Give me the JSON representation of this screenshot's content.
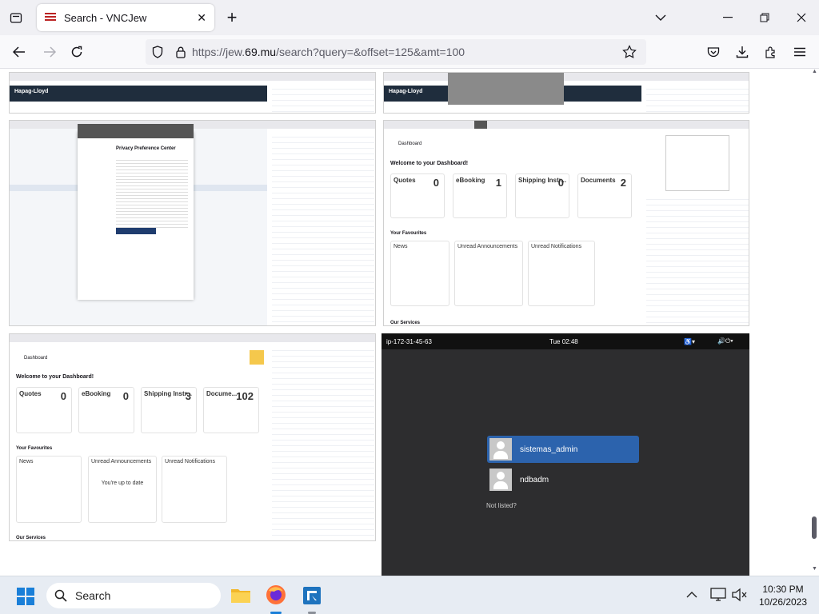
{
  "browser": {
    "tab": {
      "title": "Search - VNCJew"
    },
    "new_tab": "+",
    "url": {
      "prefix": "https://jew.",
      "host": "69.mu",
      "suffix": "/search?query=&offset=125&amt=100"
    }
  },
  "thumbnails": {
    "hapag_logo": "Hapag-Lloyd",
    "privacy_title": "Privacy Preference Center",
    "dashboard_label": "Dashboard",
    "welcome": "Welcome to your Dashboard!",
    "your_favourites": "Your Favourites",
    "news": "News",
    "unread_announcements": "Unread Announcements",
    "unread_notifications": "Unread Notifications",
    "up_to_date": "You're up to date",
    "our_services": "Our Services",
    "cards_top": [
      {
        "label": "Quotes",
        "count": "0"
      },
      {
        "label": "eBooking",
        "count": "1"
      },
      {
        "label": "Shipping Instr...",
        "count": "0"
      },
      {
        "label": "Documents",
        "count": "2"
      }
    ],
    "cards_bottom": [
      {
        "label": "Quotes",
        "count": "0"
      },
      {
        "label": "eBooking",
        "count": "0"
      },
      {
        "label": "Shipping Instr...",
        "count": "3"
      },
      {
        "label": "Docume...",
        "count": "102"
      }
    ]
  },
  "gnome": {
    "hostname": "ip-172-31-45-63",
    "time": "Tue 02:48",
    "users": [
      {
        "name": "sistemas_admin",
        "selected": true
      },
      {
        "name": "ndbadm",
        "selected": false
      }
    ],
    "not_listed": "Not listed?"
  },
  "taskbar": {
    "search_label": "Search",
    "time": "10:30 PM",
    "date": "10/26/2023"
  },
  "colors": {
    "accent": "#1f5fa8",
    "hapag_bar": "#1f2d3d",
    "gnome_bg": "#2d2d2f"
  }
}
